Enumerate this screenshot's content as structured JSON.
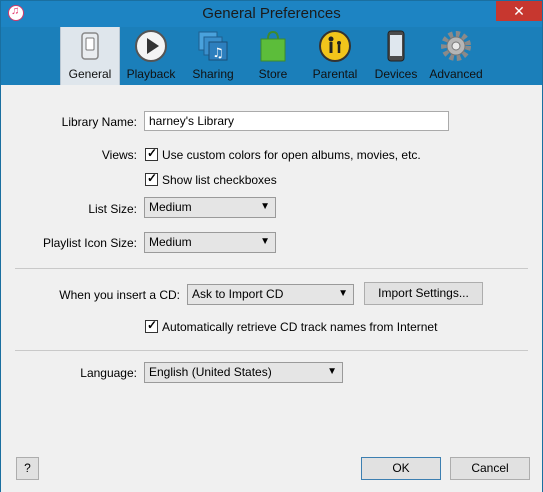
{
  "window": {
    "title": "General Preferences",
    "close_glyph": "✕",
    "accent": "#1d84c3"
  },
  "toolbar": {
    "tabs": [
      {
        "label": "General",
        "icon": "switch-icon"
      },
      {
        "label": "Playback",
        "icon": "play-icon"
      },
      {
        "label": "Sharing",
        "icon": "music-folders-icon"
      },
      {
        "label": "Store",
        "icon": "shopping-bag-icon"
      },
      {
        "label": "Parental",
        "icon": "parental-icon"
      },
      {
        "label": "Devices",
        "icon": "iphone-icon"
      },
      {
        "label": "Advanced",
        "icon": "gear-icon"
      }
    ],
    "active": "General"
  },
  "form": {
    "library_name_label": "Library Name:",
    "library_name_value": "harney's Library",
    "views_label": "Views:",
    "custom_colors_label": "Use custom colors for open albums, movies, etc.",
    "custom_colors_checked": true,
    "list_checkboxes_label": "Show list checkboxes",
    "list_checkboxes_checked": true,
    "list_size_label": "List Size:",
    "list_size_value": "Medium",
    "playlist_icon_size_label": "Playlist Icon Size:",
    "playlist_icon_size_value": "Medium",
    "insert_cd_label": "When you insert a CD:",
    "insert_cd_value": "Ask to Import CD",
    "import_settings_label": "Import Settings...",
    "auto_retrieve_label": "Automatically retrieve CD track names from Internet",
    "auto_retrieve_checked": true,
    "language_label": "Language:",
    "language_value": "English (United States)"
  },
  "footer": {
    "help_label": "?",
    "ok_label": "OK",
    "cancel_label": "Cancel"
  }
}
